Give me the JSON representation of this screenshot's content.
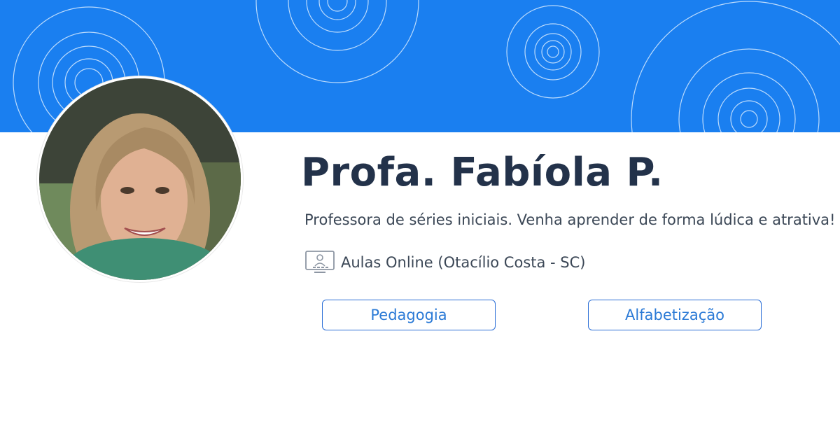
{
  "colors": {
    "banner": "#1a7ff0",
    "name": "#23324a",
    "text": "#3b4756",
    "tag_border": "#2b6ed6",
    "tag_text": "#2b7ad6"
  },
  "profile": {
    "name": "Profa. Fabíola P.",
    "bio": "Professora de séries iniciais. Venha aprender de forma lúdica e atrativa!",
    "location": "Aulas Online (Otacílio Costa - SC)",
    "location_icon": "online-class-icon",
    "avatar_icon": "profile-photo"
  },
  "tags": [
    {
      "label": "Pedagogia"
    },
    {
      "label": "Alfabetização"
    }
  ]
}
